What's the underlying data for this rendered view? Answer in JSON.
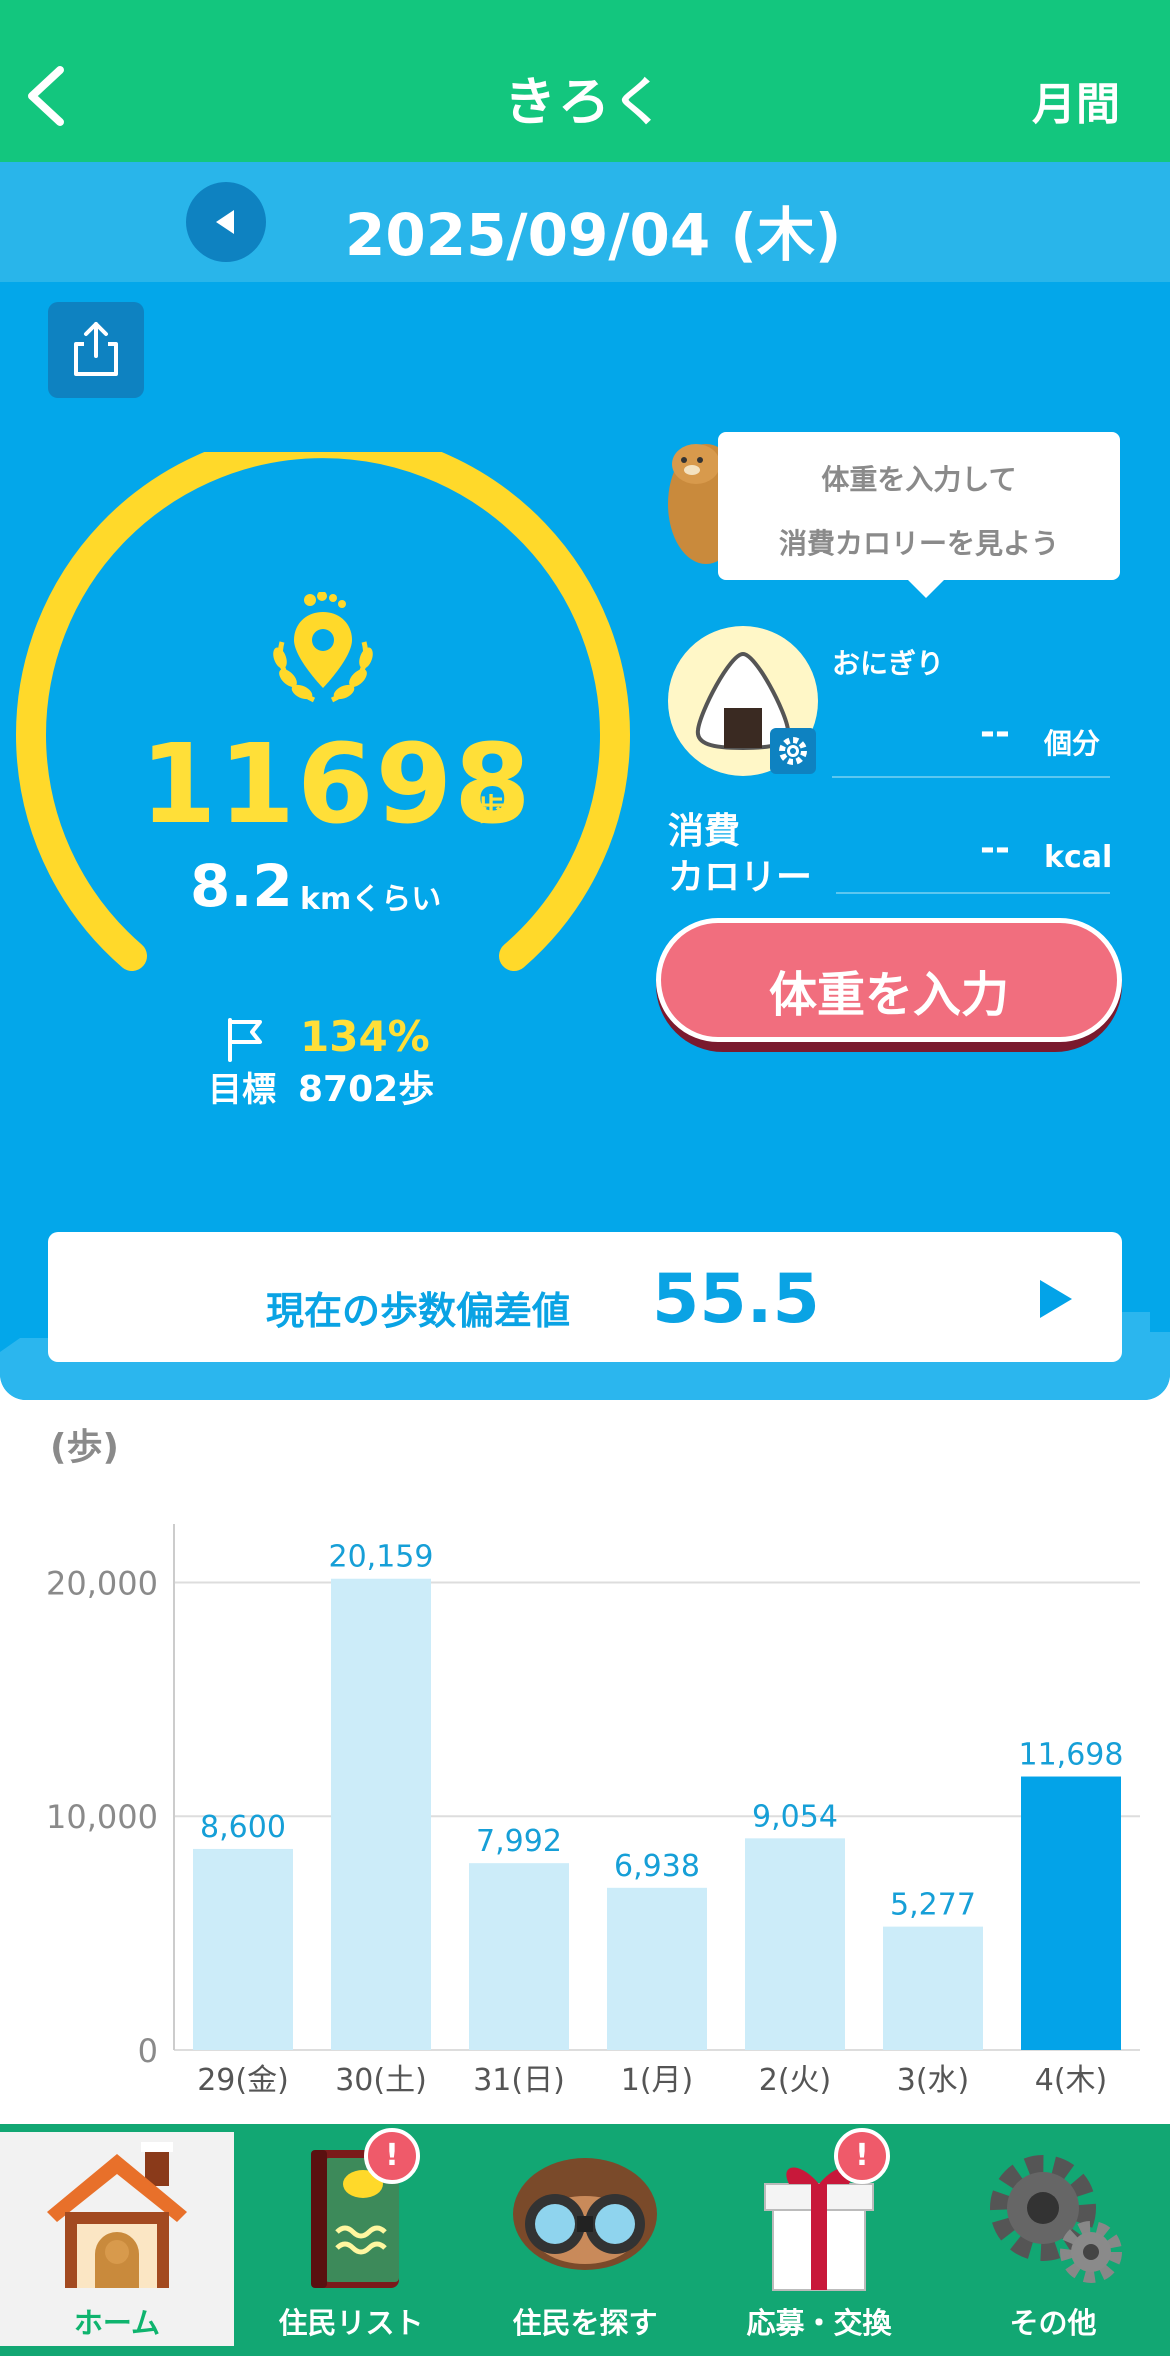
{
  "header": {
    "title": "きろく",
    "monthly": "月間"
  },
  "date": {
    "label": "2025/09/04 (木)"
  },
  "summary": {
    "steps": "11698",
    "steps_unit": "歩",
    "distance": "8.2",
    "distance_unit": "kmくらい",
    "achievement": "134%",
    "goal_label": "目標",
    "goal_value": "8702歩",
    "achievement_fraction": 1.34
  },
  "tip": {
    "line1": "体重を入力して",
    "line2": "消費カロリーを見よう"
  },
  "food": {
    "name": "おにぎり",
    "value": "--",
    "unit": "個分"
  },
  "calorie": {
    "label1": "消費",
    "label2": "カロリー",
    "value": "--",
    "unit": "kcal"
  },
  "weight_button": "体重を入力",
  "deviation": {
    "label": "現在の歩数偏差値",
    "value": "55.5"
  },
  "chart_data": {
    "type": "bar",
    "ylabel": "(歩)",
    "ylim": [
      0,
      22500
    ],
    "yticks": [
      0,
      10000,
      20000
    ],
    "ytick_labels": [
      "0",
      "10,000",
      "20,000"
    ],
    "categories": [
      "29(金)",
      "30(土)",
      "31(日)",
      "1(月)",
      "2(火)",
      "3(水)",
      "4(木)"
    ],
    "values": [
      8600,
      20159,
      7992,
      6938,
      9054,
      5277,
      11698
    ],
    "value_labels": [
      "8,600",
      "20,159",
      "7,992",
      "6,938",
      "9,054",
      "5,277",
      "11,698"
    ],
    "highlight_index": 6,
    "colors": {
      "bar": "#ccecf9",
      "highlight": "#03a3e8",
      "label": "#169fd7",
      "grid": "#dddddd"
    }
  },
  "nav": {
    "items": [
      {
        "label": "ホーム",
        "icon": "house-icon",
        "active": true
      },
      {
        "label": "住民リスト",
        "icon": "resident-book-icon",
        "badge": "!"
      },
      {
        "label": "住民を探す",
        "icon": "binoculars-icon"
      },
      {
        "label": "応募・交換",
        "icon": "gift-icon",
        "badge": "!"
      },
      {
        "label": "その他",
        "icon": "gear-icon"
      }
    ]
  },
  "colors": {
    "green": "#13c67e",
    "blue": "#03a7ea",
    "yellow": "#ffdf38",
    "pink": "#f16e7e"
  }
}
